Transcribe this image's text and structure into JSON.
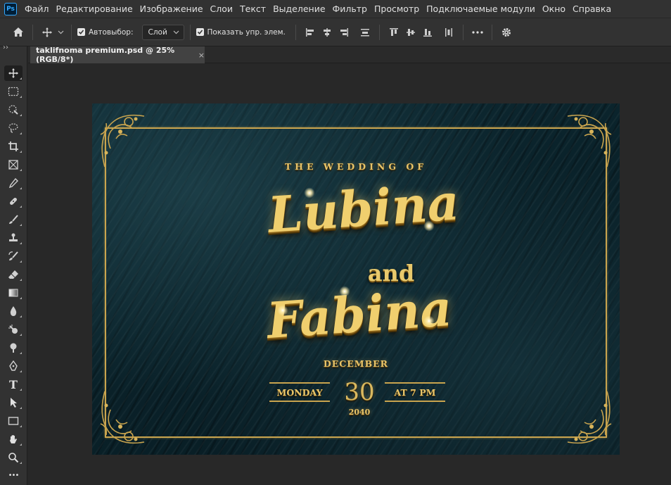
{
  "menubar": {
    "app_icon": "Ps",
    "items": [
      "Файл",
      "Редактирование",
      "Изображение",
      "Слои",
      "Текст",
      "Выделение",
      "Фильтр",
      "Просмотр",
      "Подключаемые модули",
      "Окно",
      "Справка"
    ]
  },
  "options": {
    "auto_select_label": "Автовыбор:",
    "auto_select_value": "Слой",
    "show_transform_label": "Показать упр. элем."
  },
  "document": {
    "tab_title": "taklifnoma premium.psd @ 25% (RGB/8*)",
    "close_glyph": "×"
  },
  "toolbar": {
    "collapse_glyph": "››",
    "tools": [
      "move-tool-icon",
      "marquee-tool-icon",
      "quick-selection-tool-icon",
      "lasso-tool-icon",
      "crop-tool-icon",
      "frame-tool-icon",
      "eyedropper-tool-icon",
      "healing-brush-tool-icon",
      "brush-tool-icon",
      "stamp-tool-icon",
      "history-brush-tool-icon",
      "eraser-tool-icon",
      "gradient-tool-icon",
      "blur-tool-icon",
      "dodge-tool-icon",
      "burn-tool-icon",
      "pen-tool-icon",
      "type-tool-icon",
      "path-selection-tool-icon",
      "rectangle-tool-icon",
      "hand-tool-icon",
      "zoom-tool-icon",
      "more-tools-icon"
    ],
    "type_glyph": "T",
    "more_glyph": "•••"
  },
  "invitation": {
    "heading": "THE WEDDING OF",
    "name1": "Lubina",
    "conjunction": "and",
    "name2": "Fabina",
    "month": "DECEMBER",
    "weekday": "MONDAY",
    "day": "30",
    "time": "AT 7 PM",
    "year": "2040"
  },
  "colors": {
    "gold": "#e7c46a",
    "canvas_bg": "#0c2630",
    "ui_panel": "#323232",
    "workspace": "#282828"
  }
}
